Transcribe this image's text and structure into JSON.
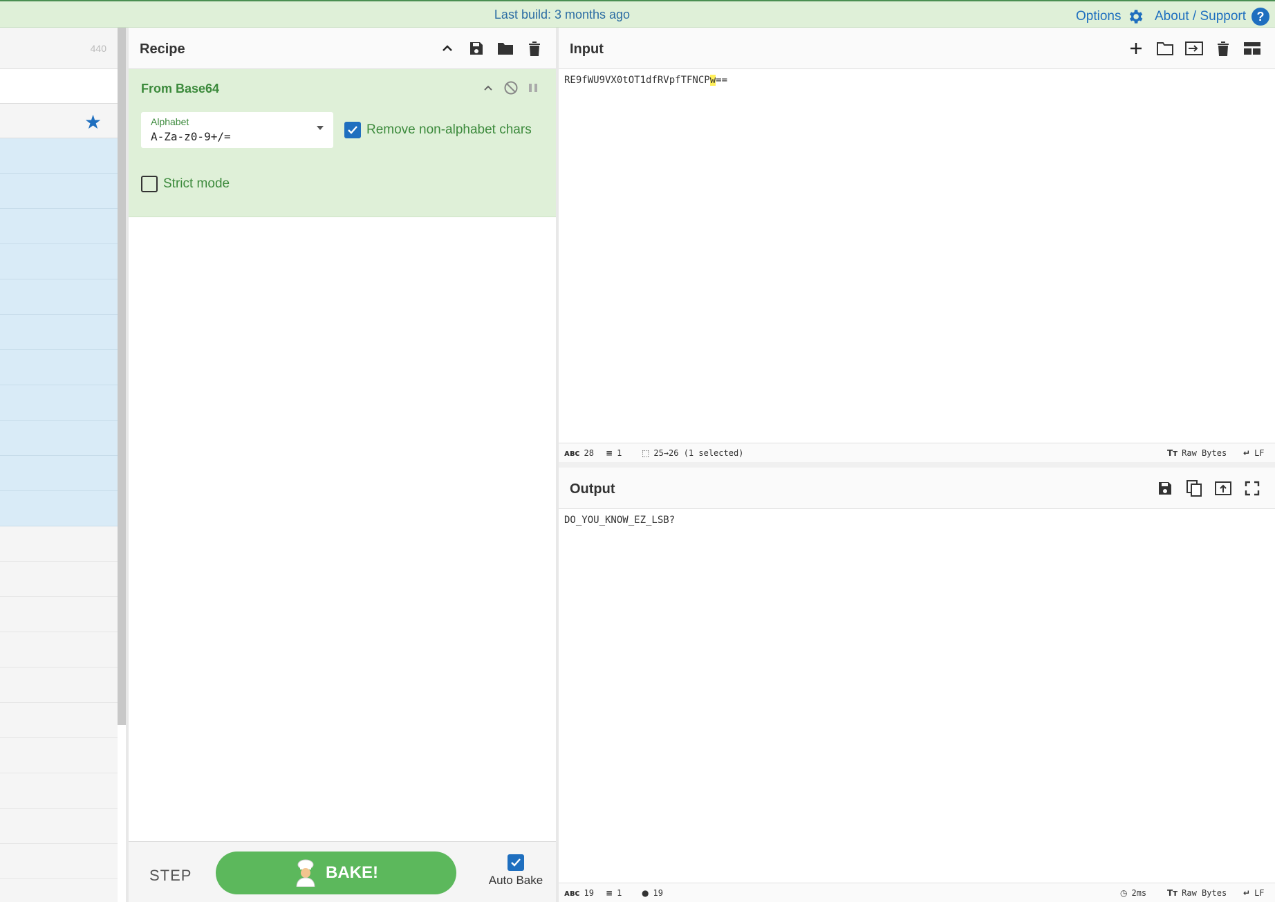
{
  "topbar": {
    "build": "Last build: 3 months ago",
    "options": "Options",
    "about": "About / Support"
  },
  "ops": {
    "count": "440"
  },
  "recipe": {
    "title": "Recipe",
    "operation": {
      "name": "From Base64",
      "alphabet_label": "Alphabet",
      "alphabet_value": "A-Za-z0-9+/=",
      "remove_nonalpha_label": "Remove non-alphabet chars",
      "remove_nonalpha_checked": true,
      "strict_label": "Strict mode",
      "strict_checked": false
    },
    "step_label": "STEP",
    "bake_label": "BAKE!",
    "autobake_label": "Auto Bake",
    "autobake_checked": true
  },
  "input": {
    "title": "Input",
    "text_before": "RE9fWU9VX0tOT1dfRVpfTFNCP",
    "text_selected": "w",
    "text_after": "==",
    "status": {
      "length": "28",
      "lines": "1",
      "selection": "25→26 (1 selected)",
      "encoding": "Raw Bytes",
      "eol": "LF"
    }
  },
  "output": {
    "title": "Output",
    "text": "DO_YOU_KNOW_EZ_LSB?",
    "status": {
      "length": "19",
      "lines": "1",
      "position": "19",
      "time": "2ms",
      "encoding": "Raw Bytes",
      "eol": "LF"
    }
  },
  "colors": {
    "accent": "#1f6fbf",
    "recipe_bg": "#dff0d8",
    "bake": "#5cb85c"
  }
}
